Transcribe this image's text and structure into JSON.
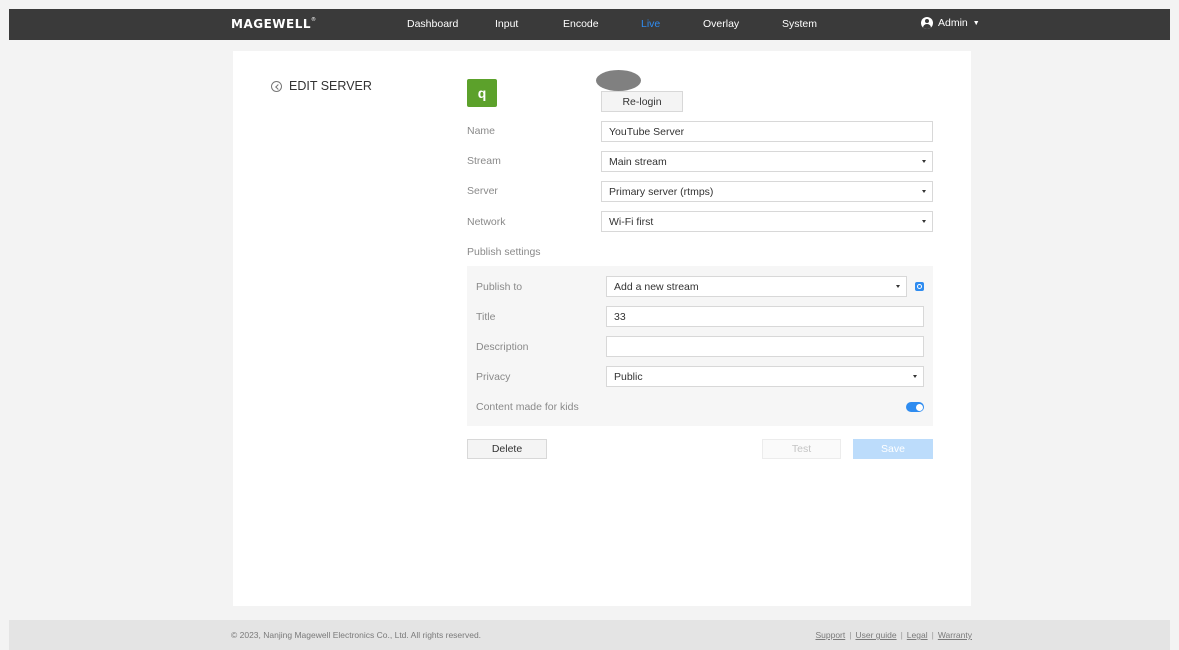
{
  "nav": {
    "logo": "MAGEWELL",
    "logo_mark": "®",
    "items": [
      {
        "label": "Dashboard",
        "active": false
      },
      {
        "label": "Input",
        "active": false
      },
      {
        "label": "Encode",
        "active": false
      },
      {
        "label": "Live",
        "active": true
      },
      {
        "label": "Overlay",
        "active": false
      },
      {
        "label": "System",
        "active": false
      }
    ],
    "user": "Admin"
  },
  "page": {
    "title": "EDIT SERVER"
  },
  "account": {
    "avatar_letter": "q",
    "relogin_label": "Re-login"
  },
  "form": {
    "name_label": "Name",
    "name_value": "YouTube Server",
    "stream_label": "Stream",
    "stream_value": "Main stream",
    "server_label": "Server",
    "server_value": "Primary server (rtmps)",
    "network_label": "Network",
    "network_value": "Wi-Fi first",
    "publish_settings_label": "Publish settings"
  },
  "publish": {
    "publish_to_label": "Publish to",
    "publish_to_value": "Add a new stream",
    "title_label": "Title",
    "title_value": "33",
    "description_label": "Description",
    "description_value": "",
    "privacy_label": "Privacy",
    "privacy_value": "Public",
    "kids_label": "Content made for kids",
    "kids_enabled": true
  },
  "actions": {
    "delete_label": "Delete",
    "test_label": "Test",
    "save_label": "Save"
  },
  "footer": {
    "copyright": "© 2023, Nanjing Magewell Electronics Co., Ltd. All rights reserved.",
    "links": [
      "Support",
      "User guide",
      "Legal",
      "Warranty"
    ]
  },
  "colors": {
    "accent": "#2f8cf0",
    "topbar": "#3a3a3a",
    "avatar": "#5ca12b"
  }
}
